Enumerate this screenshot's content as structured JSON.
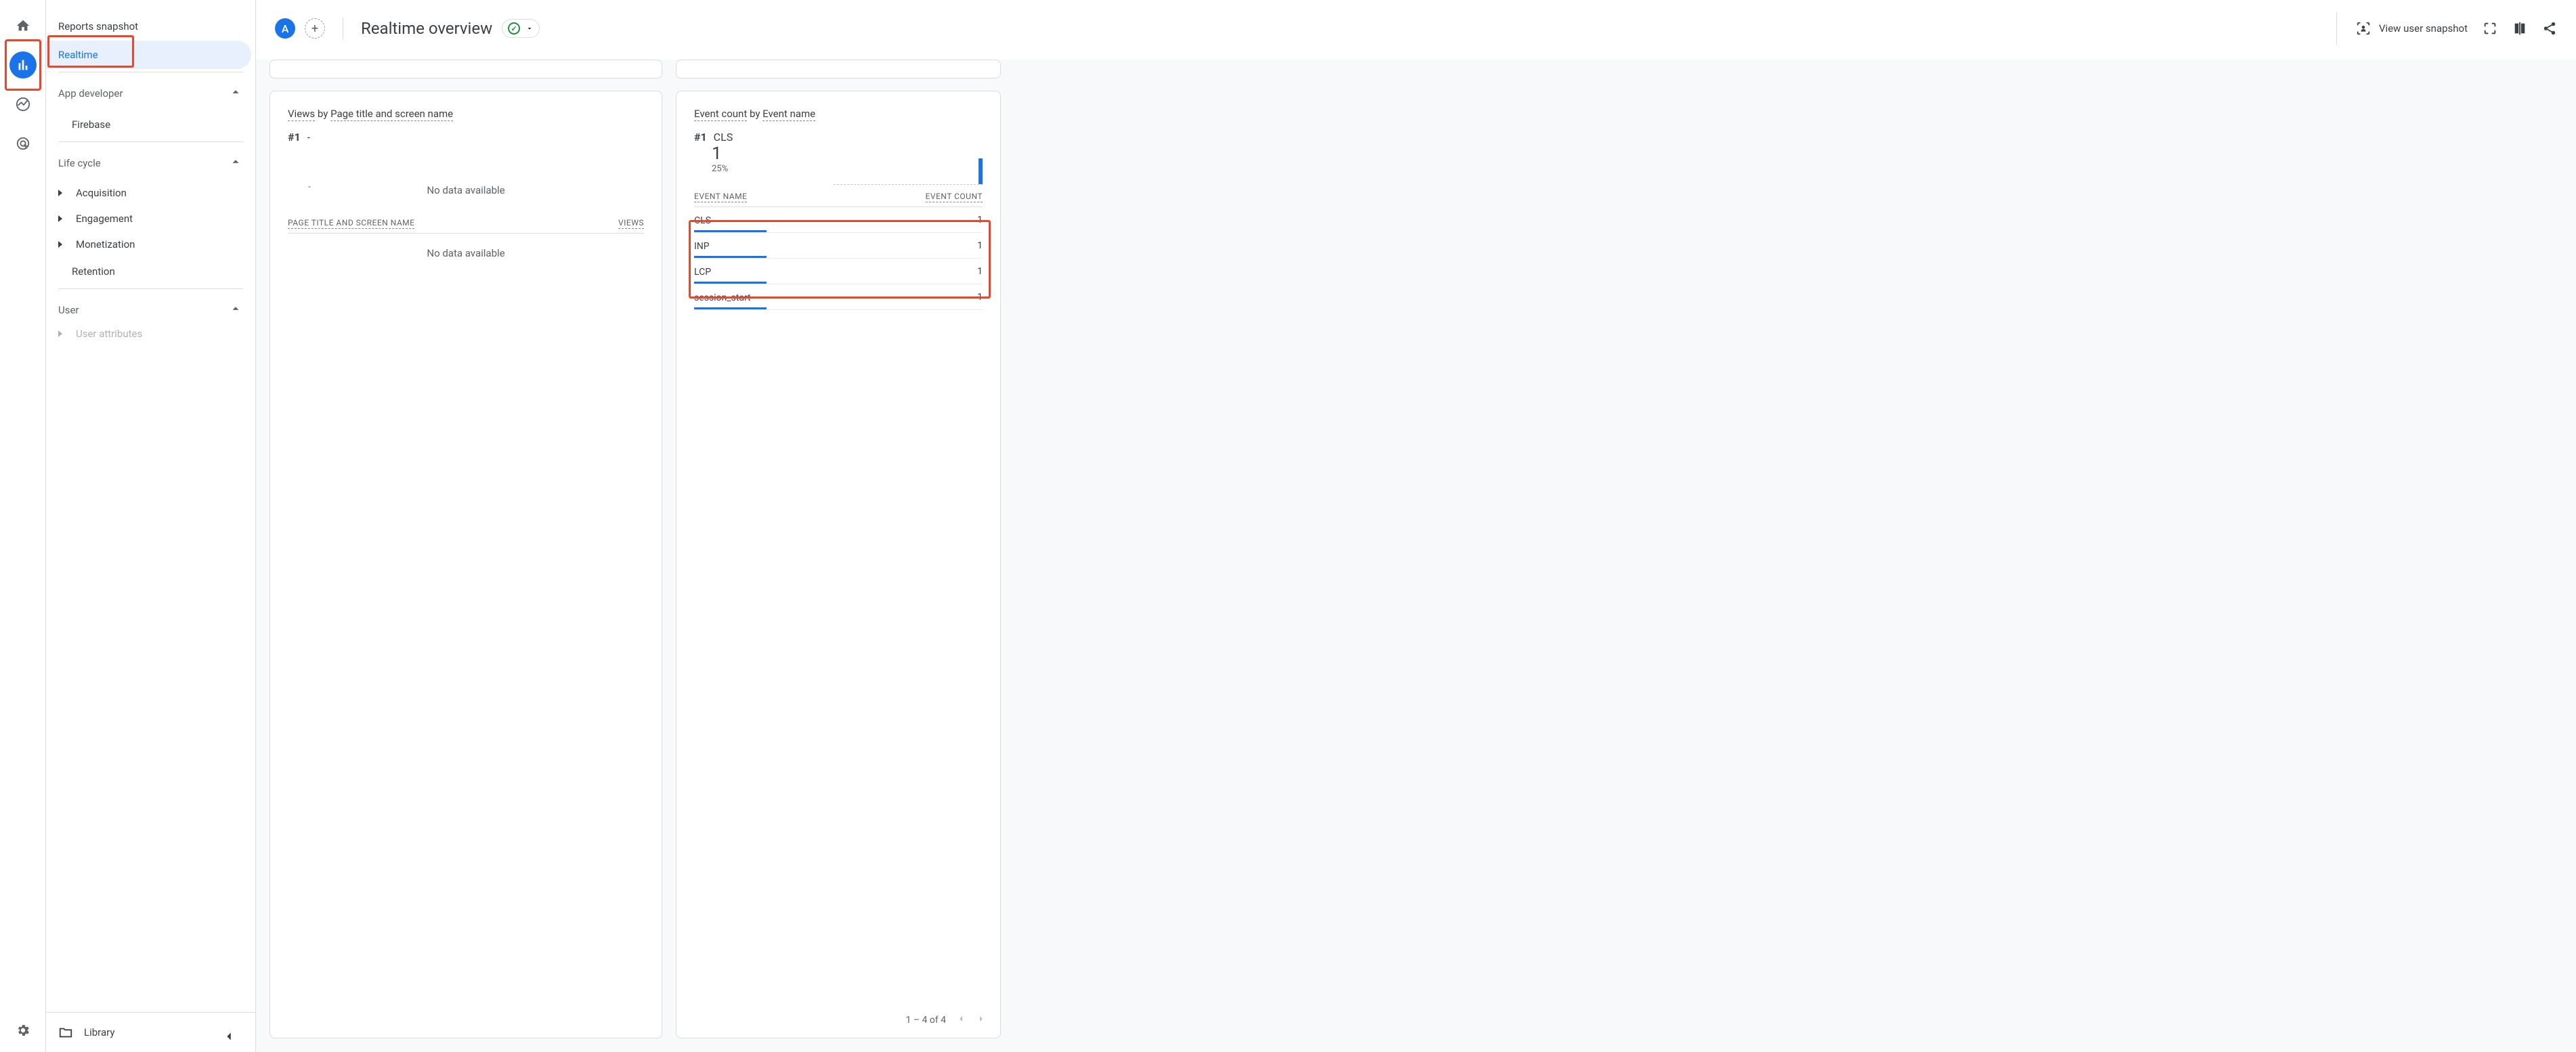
{
  "rail": {
    "items": [
      "home",
      "reports",
      "explore",
      "advertising"
    ]
  },
  "nav": {
    "reports_snapshot": "Reports snapshot",
    "realtime": "Realtime",
    "app_developer": "App developer",
    "firebase": "Firebase",
    "life_cycle": "Life cycle",
    "acquisition": "Acquisition",
    "engagement": "Engagement",
    "monetization": "Monetization",
    "retention": "Retention",
    "user": "User",
    "user_attributes": "User attributes",
    "library": "Library"
  },
  "header": {
    "avatar_letter": "A",
    "title": "Realtime overview",
    "view_snapshot": "View user snapshot"
  },
  "views_card": {
    "title_pre": "Views",
    "title_mid": " by ",
    "title_dim": "Page title and screen name",
    "rank": "#1",
    "rank_val": "-",
    "col1": "PAGE TITLE AND SCREEN NAME",
    "col2": "VIEWS",
    "nodata": "No data available",
    "dash": "-"
  },
  "events_card": {
    "title_pre": "Event count",
    "title_mid": " by ",
    "title_dim": "Event name",
    "rank": "#1",
    "rank_name": "CLS",
    "big_value": "1",
    "pct": "25%",
    "col1": "EVENT NAME",
    "col2": "EVENT COUNT",
    "rows": [
      {
        "name": "CLS",
        "count": "1",
        "bar": 25
      },
      {
        "name": "INP",
        "count": "1",
        "bar": 25
      },
      {
        "name": "LCP",
        "count": "1",
        "bar": 25
      },
      {
        "name": "session_start",
        "count": "1",
        "bar": 25
      }
    ],
    "pager": "1 – 4 of 4"
  }
}
